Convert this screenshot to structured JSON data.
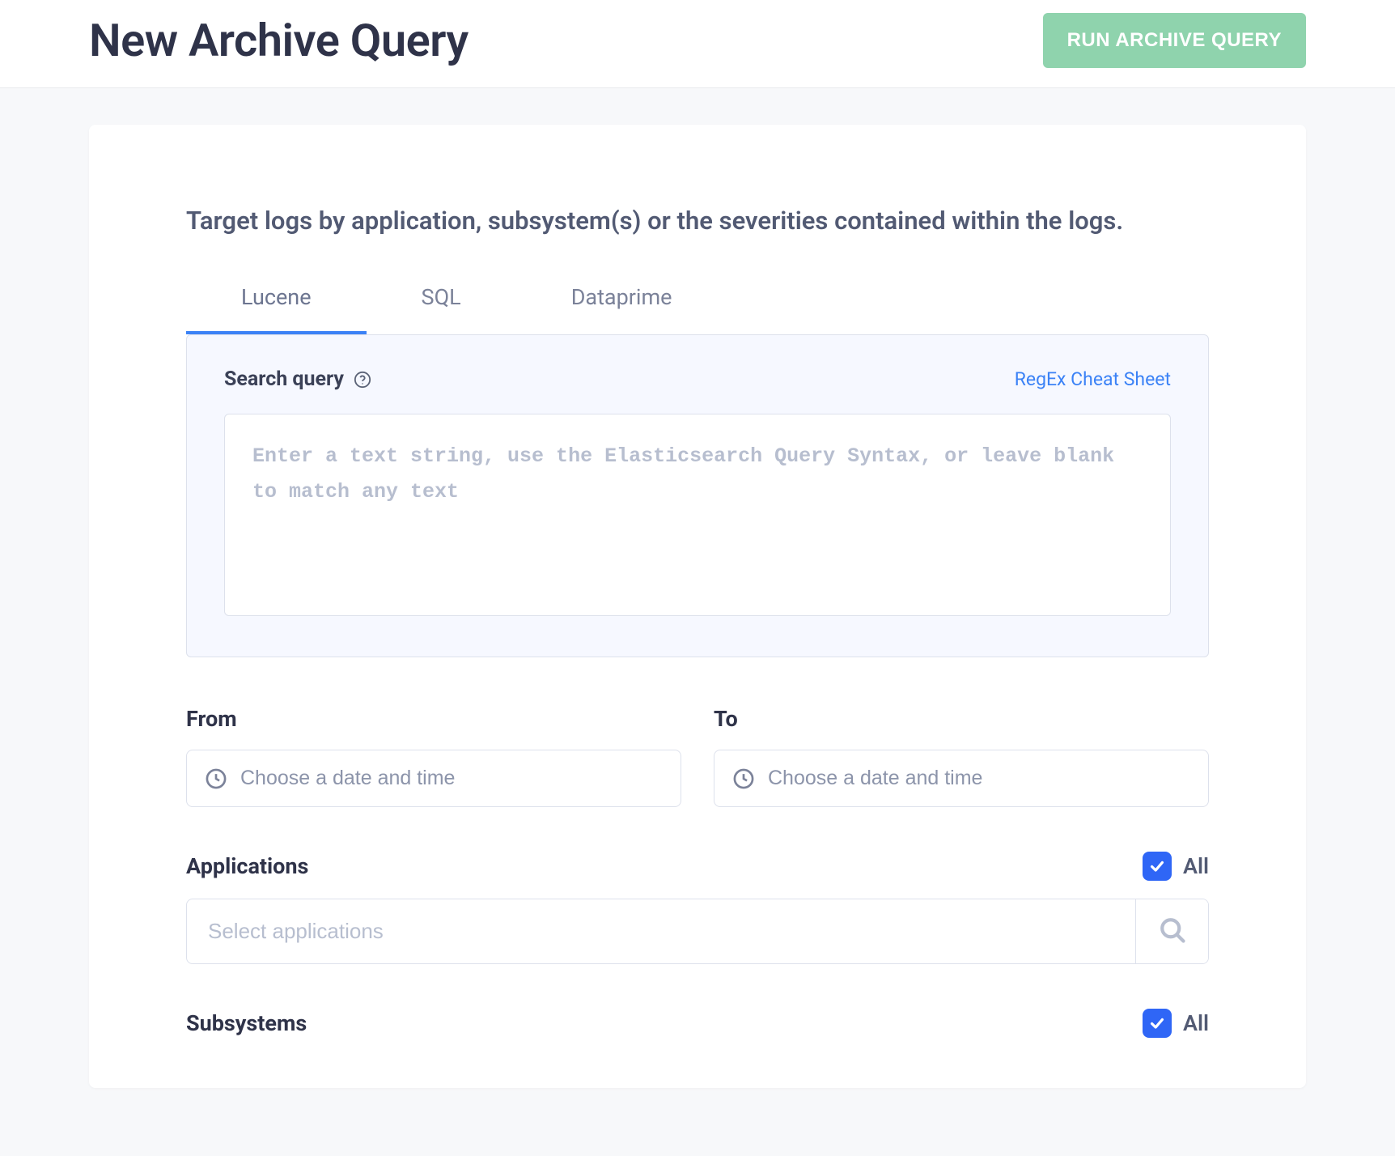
{
  "header": {
    "title": "New Archive Query",
    "run_button": "RUN ARCHIVE QUERY"
  },
  "intro": "Target logs by application, subsystem(s) or the severities contained within the logs.",
  "tabs": {
    "lucene": "Lucene",
    "sql": "SQL",
    "dataprime": "Dataprime"
  },
  "query": {
    "label": "Search query",
    "regex_link": "RegEx Cheat Sheet",
    "placeholder": "Enter a text string, use the Elasticsearch Query Syntax, or leave blank to match any text"
  },
  "from": {
    "label": "From",
    "placeholder": "Choose a date and time"
  },
  "to": {
    "label": "To",
    "placeholder": "Choose a date and time"
  },
  "applications": {
    "label": "Applications",
    "all_label": "All",
    "placeholder": "Select applications"
  },
  "subsystems": {
    "label": "Subsystems",
    "all_label": "All"
  }
}
